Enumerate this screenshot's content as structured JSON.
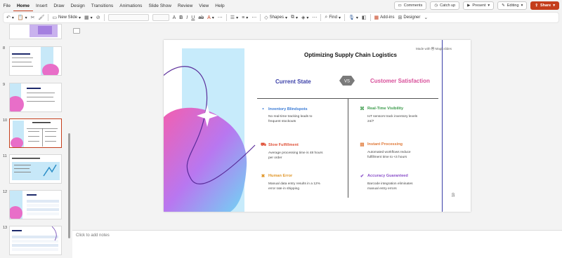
{
  "menu": [
    "File",
    "Home",
    "Insert",
    "Draw",
    "Design",
    "Transitions",
    "Animations",
    "Slide Show",
    "Review",
    "View",
    "Help"
  ],
  "top_actions": {
    "comments": "Comments",
    "catch_up": "Catch up",
    "present": "Present",
    "editing": "Editing",
    "share": "Share"
  },
  "ribbon": {
    "new_slide": "New Slide",
    "shapes": "Shapes",
    "find": "Find",
    "addins": "Add-ins",
    "designer": "Designer"
  },
  "thumbnails": [
    {
      "num": "8",
      "title": "The Competition"
    },
    {
      "num": "9",
      "title": "The Competition"
    },
    {
      "num": "10",
      "title": "Optimizing Supply Chain Logistics"
    },
    {
      "num": "11",
      "title": "Optimizing Supply Chain Logistics"
    },
    {
      "num": "12",
      "title": "The Data"
    },
    {
      "num": "13",
      "title": "The Data"
    }
  ],
  "notes_placeholder": "Click to add notes",
  "slide": {
    "title": "Optimizing Supply Chain Logistics",
    "made_with": "Made with",
    "made_with_brand": "Magicslides",
    "left_heading": "Current State",
    "right_heading": "Customer Satisfaction",
    "vs": "VS",
    "page_number": "10",
    "left_items": [
      {
        "title": "Inventory Blindspots",
        "desc1": "No real-time tracking leads to",
        "desc2": "frequent stockouts",
        "color": "#3a7bd5"
      },
      {
        "title": "Slow Fulfillment",
        "desc1": "Average processing time is 48 hours",
        "desc2": "per order",
        "color": "#e0533a"
      },
      {
        "title": "Human Error",
        "desc1": "Manual data entry results in a 12%",
        "desc2": "error rate in shipping",
        "color": "#e0972a"
      }
    ],
    "right_items": [
      {
        "title": "Real-Time Visibility",
        "desc1": "IoT sensors track inventory levels",
        "desc2": "24/7",
        "color": "#3a9a4a"
      },
      {
        "title": "Instant Processing",
        "desc1": "Automated workflows reduce",
        "desc2": "fulfillment time to <4 hours",
        "color": "#e07a3a"
      },
      {
        "title": "Accuracy Guaranteed",
        "desc1": "Barcode integration eliminates",
        "desc2": "manual entry errors",
        "color": "#8a4fc9"
      }
    ]
  }
}
